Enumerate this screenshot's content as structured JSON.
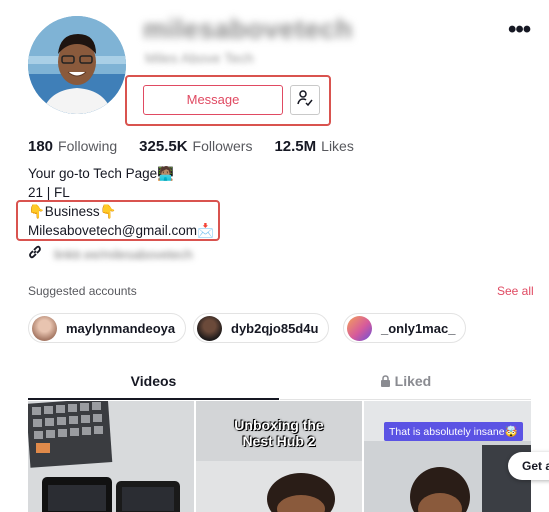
{
  "profile": {
    "username": "milesabovetech",
    "nickname": "Miles Above Tech",
    "message_label": "Message",
    "stats": [
      {
        "value": "180",
        "label": "Following"
      },
      {
        "value": "325.5K",
        "label": "Followers"
      },
      {
        "value": "12.5M",
        "label": "Likes"
      }
    ],
    "bio": [
      "Your go-to Tech Page🧑🏽‍💻",
      "21 | FL",
      "👇Business👇",
      "Milesabovetech@gmail.com📩"
    ],
    "link": "linktr.ee/milesabovetech"
  },
  "suggested": {
    "title": "Suggested accounts",
    "see_all": "See all",
    "accounts": [
      "maylynmandeoya",
      "dyb2qjo85d4u",
      "_only1mac_"
    ]
  },
  "tabs": {
    "videos": "Videos",
    "liked": "Liked"
  },
  "videos": [
    {
      "caption": ""
    },
    {
      "caption": "Unboxing the\nNest Hub 2"
    },
    {
      "caption": "That is absolutely insane🤯"
    }
  ],
  "get_app": "Get a",
  "colors": {
    "accent": "#e04a62",
    "highlight_box": "#d9534f",
    "caption_bg": "#5b53e4"
  },
  "icons": {
    "more": "more-dots-icon",
    "follow": "user-check-icon",
    "link": "link-icon",
    "lock": "lock-icon"
  }
}
